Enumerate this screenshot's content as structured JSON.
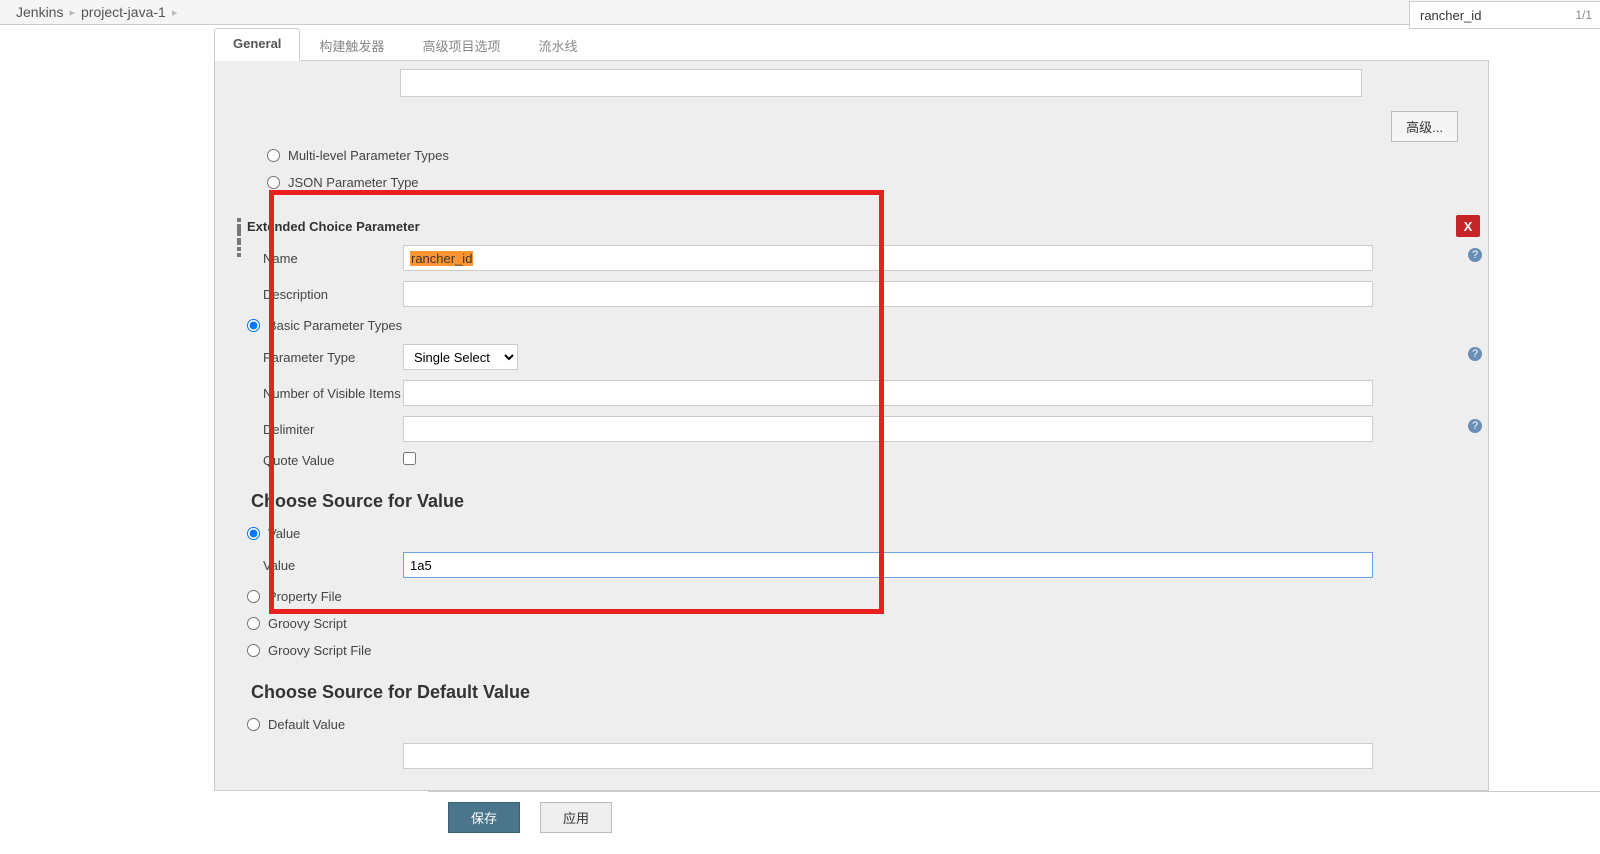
{
  "breadcrumb": {
    "items": [
      "Jenkins",
      "project-java-1"
    ]
  },
  "search_pill": {
    "text": "rancher_id",
    "count": "1/1"
  },
  "tabs": [
    {
      "label": "General",
      "active": true
    },
    {
      "label": "构建触发器",
      "active": false
    },
    {
      "label": "高级项目选项",
      "active": false
    },
    {
      "label": "流水线",
      "active": false
    }
  ],
  "top": {
    "advanced_btn": "高级...",
    "radios": {
      "multi_level": "Multi-level Parameter Types",
      "json": "JSON Parameter Type"
    }
  },
  "ext_param": {
    "header": "Extended Choice Parameter",
    "delete_label": "X",
    "rows": {
      "name_label": "Name",
      "name_value": "rancher_id",
      "desc_label": "Description",
      "desc_value": "",
      "basic_radio": "Basic Parameter Types",
      "ptype_label": "Parameter Type",
      "ptype_value": "Single Select",
      "visible_label": "Number of Visible Items",
      "visible_value": "",
      "delim_label": "Delimiter",
      "delim_value": "",
      "quote_label": "Quote Value"
    },
    "source_heading": "Choose Source for Value",
    "source": {
      "value_radio": "Value",
      "value_label": "Value",
      "value_value": "1a5",
      "propfile_radio": "Property File",
      "groovy_radio": "Groovy Script",
      "groovyfile_radio": "Groovy Script File"
    },
    "default_heading": "Choose Source for Default Value",
    "default": {
      "default_radio": "Default Value"
    }
  },
  "buttons": {
    "save": "保存",
    "apply": "应用"
  }
}
